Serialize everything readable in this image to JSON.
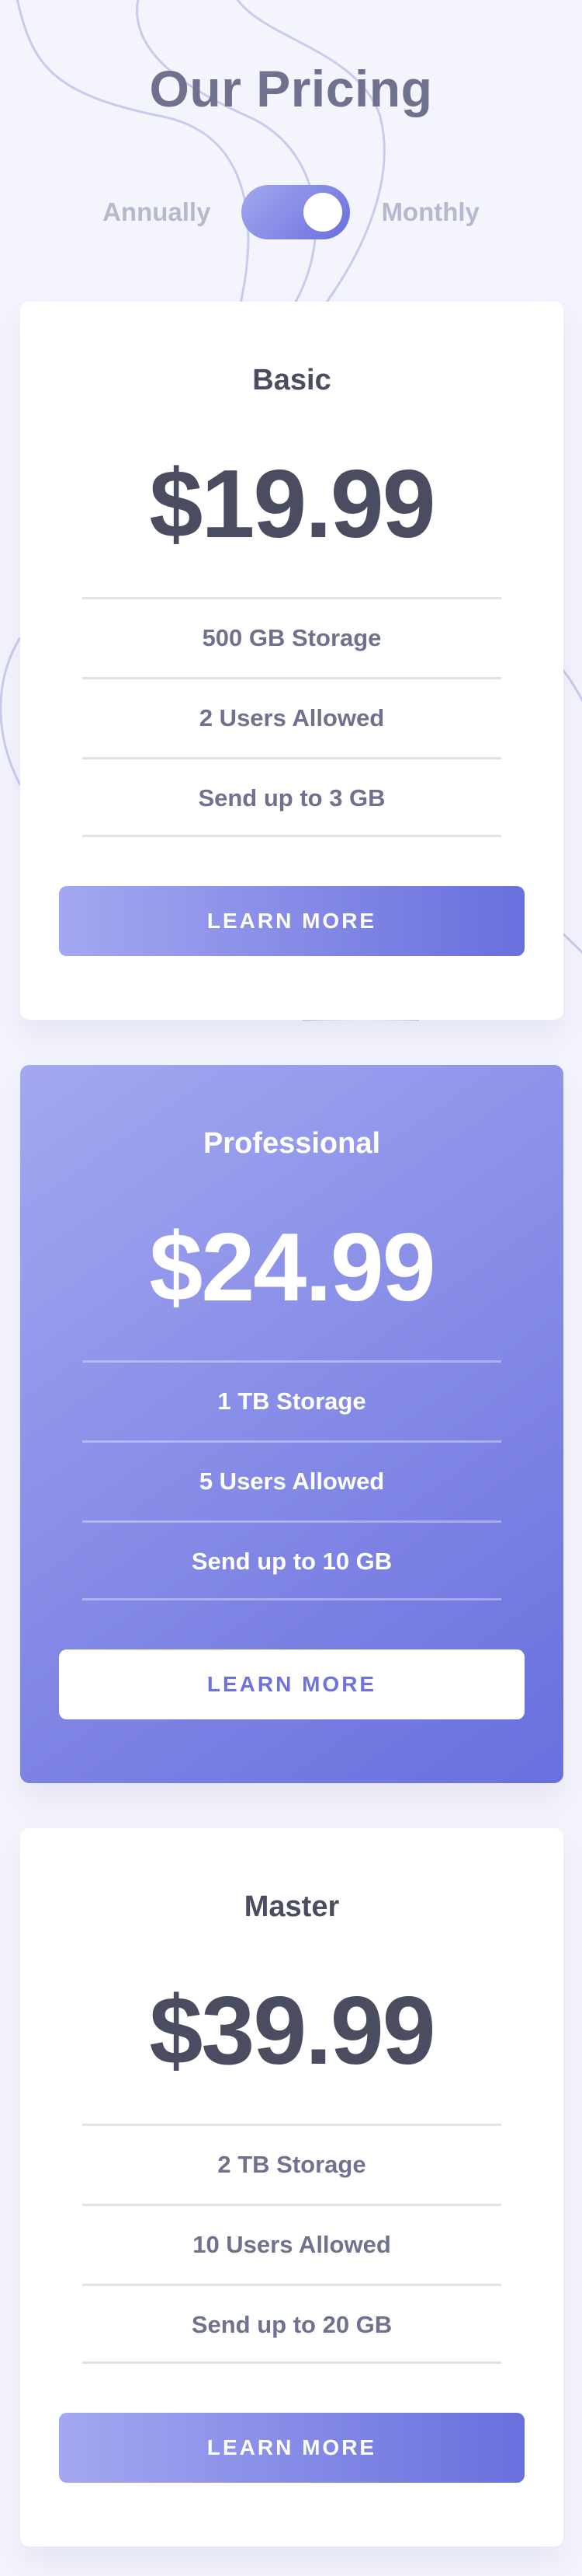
{
  "header": {
    "title": "Our Pricing",
    "toggle_left_label": "Annually",
    "toggle_right_label": "Monthly",
    "toggle_state": "monthly"
  },
  "colors": {
    "background": "#f4f4fd",
    "accent_light": "#a3a8f0",
    "accent_dark": "#696fdd",
    "text_dark": "#4a4d60",
    "text_muted": "#6e728e"
  },
  "plans": [
    {
      "name": "Basic",
      "price": "$19.99",
      "features": [
        "500 GB Storage",
        "2 Users Allowed",
        "Send up to 3 GB"
      ],
      "button_label": "LEARN MORE"
    },
    {
      "name": "Professional",
      "price": "$24.99",
      "features": [
        "1 TB Storage",
        "5 Users Allowed",
        "Send up to 10 GB"
      ],
      "button_label": "LEARN MORE"
    },
    {
      "name": "Master",
      "price": "$39.99",
      "features": [
        "2 TB Storage",
        "10 Users Allowed",
        "Send up to 20 GB"
      ],
      "button_label": "LEARN MORE"
    }
  ]
}
